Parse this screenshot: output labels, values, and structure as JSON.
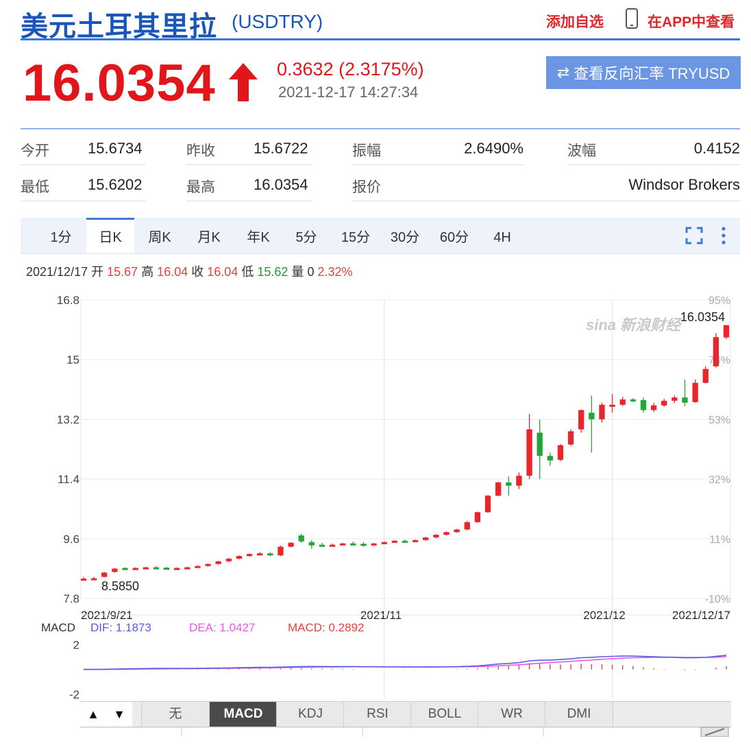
{
  "header": {
    "title": "美元土耳其里拉",
    "code": "(USDTRY)",
    "add_watch": "添加自选",
    "app_view": "在APP中查看"
  },
  "quote": {
    "price": "16.0354",
    "change": "0.3632 (2.3175%)",
    "timestamp": "2021-12-17 14:27:34",
    "reverse_button": "查看反向汇率 TRYUSD",
    "up_color": "#e0161b"
  },
  "stats": [
    {
      "label": "今开",
      "value": "15.6734"
    },
    {
      "label": "昨收",
      "value": "15.6722"
    },
    {
      "label": "振幅",
      "value": "2.6490%"
    },
    {
      "label": "波幅",
      "value": "0.4152"
    },
    {
      "label": "最低",
      "value": "15.6202"
    },
    {
      "label": "最高",
      "value": "16.0354"
    },
    {
      "label": "报价",
      "value": ""
    },
    {
      "label": "",
      "value": "Windsor Brokers"
    }
  ],
  "tabs": [
    {
      "label": "1分",
      "active": false
    },
    {
      "label": "日K",
      "active": true
    },
    {
      "label": "周K",
      "active": false
    },
    {
      "label": "月K",
      "active": false
    },
    {
      "label": "年K",
      "active": false
    },
    {
      "label": "5分",
      "active": false
    },
    {
      "label": "15分",
      "active": false
    },
    {
      "label": "30分",
      "active": false
    },
    {
      "label": "60分",
      "active": false
    },
    {
      "label": "4H",
      "active": false
    }
  ],
  "ohlc": {
    "date": "2021/12/17",
    "open_label": "开",
    "open": "15.67",
    "high_label": "高",
    "high": "16.04",
    "close_label": "收",
    "close": "16.04",
    "low_label": "低",
    "low": "15.62",
    "vol_label": "量",
    "vol": "0",
    "pct": "2.32%"
  },
  "chart_data": {
    "type": "candlestick",
    "y_ticks": [
      "16.8",
      "15",
      "13.2",
      "11.4",
      "9.6",
      "7.8"
    ],
    "y_right_ticks": [
      "95%",
      "74%",
      "53%",
      "32%",
      "11%",
      "-10%"
    ],
    "ylim": [
      7.8,
      16.8
    ],
    "x_labels": [
      "2021/9/21",
      "2021/11",
      "2021/12",
      "2021/12/17"
    ],
    "max_label": "16.0354",
    "min_label": "8.5850",
    "up_color": "#e8262c",
    "down_color": "#22a63a",
    "candles": [
      [
        8.4,
        8.45,
        8.38,
        8.4
      ],
      [
        8.4,
        8.45,
        8.38,
        8.41
      ],
      [
        8.45,
        8.6,
        8.44,
        8.58
      ],
      [
        8.6,
        8.72,
        8.58,
        8.7
      ],
      [
        8.72,
        8.74,
        8.66,
        8.68
      ],
      [
        8.68,
        8.74,
        8.66,
        8.72
      ],
      [
        8.72,
        8.76,
        8.7,
        8.74
      ],
      [
        8.74,
        8.78,
        8.7,
        8.73
      ],
      [
        8.73,
        8.76,
        8.68,
        8.7
      ],
      [
        8.7,
        8.74,
        8.68,
        8.72
      ],
      [
        8.72,
        8.76,
        8.7,
        8.74
      ],
      [
        8.74,
        8.8,
        8.72,
        8.78
      ],
      [
        8.78,
        8.86,
        8.76,
        8.84
      ],
      [
        8.84,
        8.94,
        8.82,
        8.92
      ],
      [
        8.92,
        9.02,
        8.9,
        9.0
      ],
      [
        9.0,
        9.1,
        8.98,
        9.08
      ],
      [
        9.08,
        9.16,
        9.06,
        9.14
      ],
      [
        9.14,
        9.2,
        9.1,
        9.16
      ],
      [
        9.16,
        9.2,
        9.08,
        9.1
      ],
      [
        9.1,
        9.4,
        9.08,
        9.36
      ],
      [
        9.36,
        9.5,
        9.34,
        9.48
      ],
      [
        9.7,
        9.76,
        9.48,
        9.52
      ],
      [
        9.5,
        9.56,
        9.3,
        9.4
      ],
      [
        9.42,
        9.48,
        9.38,
        9.4
      ],
      [
        9.4,
        9.46,
        9.38,
        9.42
      ],
      [
        9.42,
        9.48,
        9.4,
        9.46
      ],
      [
        9.46,
        9.52,
        9.42,
        9.45
      ],
      [
        9.45,
        9.5,
        9.36,
        9.4
      ],
      [
        9.4,
        9.48,
        9.38,
        9.46
      ],
      [
        9.46,
        9.52,
        9.44,
        9.5
      ],
      [
        9.5,
        9.56,
        9.48,
        9.54
      ],
      [
        9.54,
        9.58,
        9.5,
        9.52
      ],
      [
        9.52,
        9.58,
        9.5,
        9.56
      ],
      [
        9.56,
        9.66,
        9.54,
        9.64
      ],
      [
        9.64,
        9.74,
        9.62,
        9.72
      ],
      [
        9.72,
        9.82,
        9.7,
        9.8
      ],
      [
        9.8,
        9.9,
        9.78,
        9.88
      ],
      [
        9.88,
        10.14,
        9.86,
        10.1
      ],
      [
        10.1,
        10.42,
        10.08,
        10.4
      ],
      [
        10.4,
        10.92,
        10.38,
        10.9
      ],
      [
        10.9,
        11.32,
        10.88,
        11.3
      ],
      [
        11.3,
        11.48,
        10.9,
        11.2
      ],
      [
        11.2,
        11.6,
        11.1,
        11.5
      ],
      [
        11.5,
        13.36,
        11.4,
        12.9
      ],
      [
        12.8,
        13.2,
        11.4,
        12.1
      ],
      [
        12.1,
        12.2,
        11.8,
        11.96
      ],
      [
        11.98,
        12.46,
        11.94,
        12.42
      ],
      [
        12.44,
        12.9,
        12.4,
        12.84
      ],
      [
        12.9,
        13.5,
        12.8,
        13.48
      ],
      [
        13.4,
        13.92,
        12.2,
        13.2
      ],
      [
        13.2,
        13.7,
        13.1,
        13.64
      ],
      [
        13.6,
        13.96,
        13.4,
        13.64
      ],
      [
        13.64,
        13.88,
        13.6,
        13.8
      ],
      [
        13.8,
        13.84,
        13.72,
        13.76
      ],
      [
        13.78,
        13.86,
        13.4,
        13.48
      ],
      [
        13.48,
        13.7,
        13.42,
        13.62
      ],
      [
        13.62,
        13.82,
        13.58,
        13.76
      ],
      [
        13.76,
        13.92,
        13.7,
        13.86
      ],
      [
        13.86,
        14.4,
        13.6,
        13.7
      ],
      [
        13.72,
        14.4,
        13.7,
        14.3
      ],
      [
        14.3,
        14.8,
        14.28,
        14.72
      ],
      [
        14.8,
        15.8,
        14.76,
        15.68
      ],
      [
        15.67,
        16.04,
        15.62,
        16.04
      ]
    ]
  },
  "macd": {
    "label": "MACD",
    "dif_label": "DIF: 1.1873",
    "dea_label": "DEA: 1.0427",
    "macd_label": "MACD: 0.2892",
    "dif_color": "#5a5ae6",
    "dea_color": "#e65ae0",
    "macd_color": "#e84040",
    "y_ticks": [
      "2",
      "-2"
    ],
    "ylim": [
      -2,
      2.4
    ]
  },
  "indicator_tabs": [
    {
      "label": "无",
      "active": false
    },
    {
      "label": "MACD",
      "active": true
    },
    {
      "label": "KDJ",
      "active": false
    },
    {
      "label": "RSI",
      "active": false
    },
    {
      "label": "BOLL",
      "active": false
    },
    {
      "label": "WR",
      "active": false
    },
    {
      "label": "DMI",
      "active": false
    }
  ],
  "arrows": {
    "up": "▲",
    "down": "▼"
  }
}
